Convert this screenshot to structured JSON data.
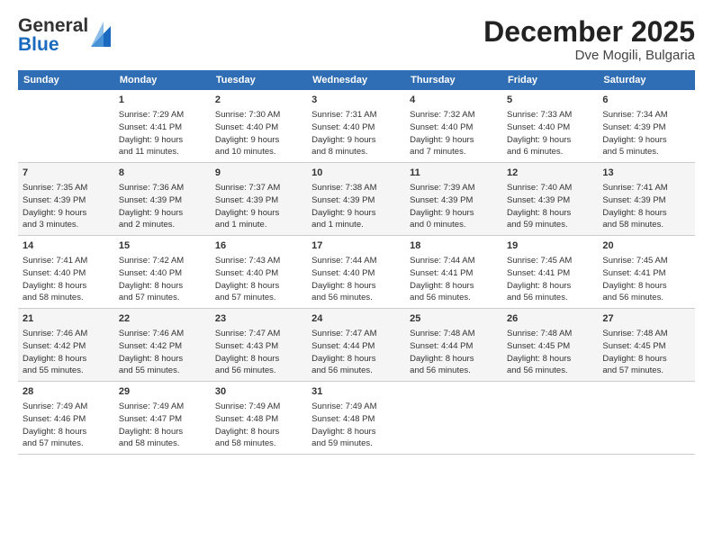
{
  "header": {
    "logo_general": "General",
    "logo_blue": "Blue",
    "month_title": "December 2025",
    "location": "Dve Mogili, Bulgaria"
  },
  "days_of_week": [
    "Sunday",
    "Monday",
    "Tuesday",
    "Wednesday",
    "Thursday",
    "Friday",
    "Saturday"
  ],
  "weeks": [
    [
      {
        "day": "",
        "content": ""
      },
      {
        "day": "1",
        "content": "Sunrise: 7:29 AM\nSunset: 4:41 PM\nDaylight: 9 hours\nand 11 minutes."
      },
      {
        "day": "2",
        "content": "Sunrise: 7:30 AM\nSunset: 4:40 PM\nDaylight: 9 hours\nand 10 minutes."
      },
      {
        "day": "3",
        "content": "Sunrise: 7:31 AM\nSunset: 4:40 PM\nDaylight: 9 hours\nand 8 minutes."
      },
      {
        "day": "4",
        "content": "Sunrise: 7:32 AM\nSunset: 4:40 PM\nDaylight: 9 hours\nand 7 minutes."
      },
      {
        "day": "5",
        "content": "Sunrise: 7:33 AM\nSunset: 4:40 PM\nDaylight: 9 hours\nand 6 minutes."
      },
      {
        "day": "6",
        "content": "Sunrise: 7:34 AM\nSunset: 4:39 PM\nDaylight: 9 hours\nand 5 minutes."
      }
    ],
    [
      {
        "day": "7",
        "content": "Sunrise: 7:35 AM\nSunset: 4:39 PM\nDaylight: 9 hours\nand 3 minutes."
      },
      {
        "day": "8",
        "content": "Sunrise: 7:36 AM\nSunset: 4:39 PM\nDaylight: 9 hours\nand 2 minutes."
      },
      {
        "day": "9",
        "content": "Sunrise: 7:37 AM\nSunset: 4:39 PM\nDaylight: 9 hours\nand 1 minute."
      },
      {
        "day": "10",
        "content": "Sunrise: 7:38 AM\nSunset: 4:39 PM\nDaylight: 9 hours\nand 1 minute."
      },
      {
        "day": "11",
        "content": "Sunrise: 7:39 AM\nSunset: 4:39 PM\nDaylight: 9 hours\nand 0 minutes."
      },
      {
        "day": "12",
        "content": "Sunrise: 7:40 AM\nSunset: 4:39 PM\nDaylight: 8 hours\nand 59 minutes."
      },
      {
        "day": "13",
        "content": "Sunrise: 7:41 AM\nSunset: 4:39 PM\nDaylight: 8 hours\nand 58 minutes."
      }
    ],
    [
      {
        "day": "14",
        "content": "Sunrise: 7:41 AM\nSunset: 4:40 PM\nDaylight: 8 hours\nand 58 minutes."
      },
      {
        "day": "15",
        "content": "Sunrise: 7:42 AM\nSunset: 4:40 PM\nDaylight: 8 hours\nand 57 minutes."
      },
      {
        "day": "16",
        "content": "Sunrise: 7:43 AM\nSunset: 4:40 PM\nDaylight: 8 hours\nand 57 minutes."
      },
      {
        "day": "17",
        "content": "Sunrise: 7:44 AM\nSunset: 4:40 PM\nDaylight: 8 hours\nand 56 minutes."
      },
      {
        "day": "18",
        "content": "Sunrise: 7:44 AM\nSunset: 4:41 PM\nDaylight: 8 hours\nand 56 minutes."
      },
      {
        "day": "19",
        "content": "Sunrise: 7:45 AM\nSunset: 4:41 PM\nDaylight: 8 hours\nand 56 minutes."
      },
      {
        "day": "20",
        "content": "Sunrise: 7:45 AM\nSunset: 4:41 PM\nDaylight: 8 hours\nand 56 minutes."
      }
    ],
    [
      {
        "day": "21",
        "content": "Sunrise: 7:46 AM\nSunset: 4:42 PM\nDaylight: 8 hours\nand 55 minutes."
      },
      {
        "day": "22",
        "content": "Sunrise: 7:46 AM\nSunset: 4:42 PM\nDaylight: 8 hours\nand 55 minutes."
      },
      {
        "day": "23",
        "content": "Sunrise: 7:47 AM\nSunset: 4:43 PM\nDaylight: 8 hours\nand 56 minutes."
      },
      {
        "day": "24",
        "content": "Sunrise: 7:47 AM\nSunset: 4:44 PM\nDaylight: 8 hours\nand 56 minutes."
      },
      {
        "day": "25",
        "content": "Sunrise: 7:48 AM\nSunset: 4:44 PM\nDaylight: 8 hours\nand 56 minutes."
      },
      {
        "day": "26",
        "content": "Sunrise: 7:48 AM\nSunset: 4:45 PM\nDaylight: 8 hours\nand 56 minutes."
      },
      {
        "day": "27",
        "content": "Sunrise: 7:48 AM\nSunset: 4:45 PM\nDaylight: 8 hours\nand 57 minutes."
      }
    ],
    [
      {
        "day": "28",
        "content": "Sunrise: 7:49 AM\nSunset: 4:46 PM\nDaylight: 8 hours\nand 57 minutes."
      },
      {
        "day": "29",
        "content": "Sunrise: 7:49 AM\nSunset: 4:47 PM\nDaylight: 8 hours\nand 58 minutes."
      },
      {
        "day": "30",
        "content": "Sunrise: 7:49 AM\nSunset: 4:48 PM\nDaylight: 8 hours\nand 58 minutes."
      },
      {
        "day": "31",
        "content": "Sunrise: 7:49 AM\nSunset: 4:48 PM\nDaylight: 8 hours\nand 59 minutes."
      },
      {
        "day": "",
        "content": ""
      },
      {
        "day": "",
        "content": ""
      },
      {
        "day": "",
        "content": ""
      }
    ]
  ]
}
